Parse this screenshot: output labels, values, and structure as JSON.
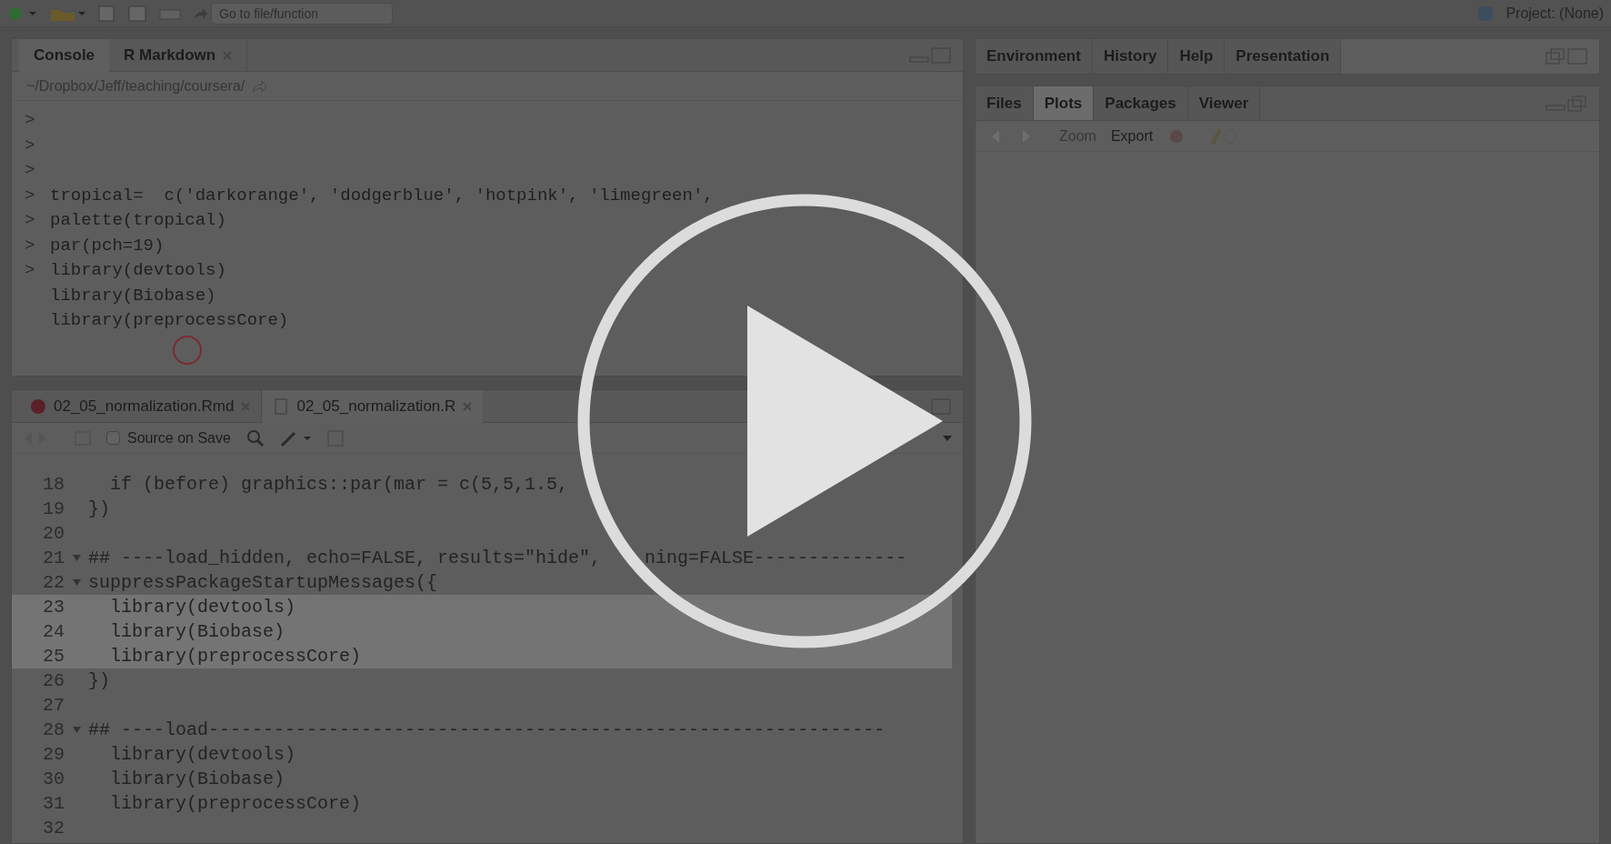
{
  "toolbar": {
    "search": {
      "placeholder": "Go to file/function"
    },
    "project": "Project: (None)"
  },
  "console_pane": {
    "tabs": [
      {
        "label": "Console",
        "selected": true,
        "closable": false
      },
      {
        "label": "R Markdown",
        "selected": false,
        "closable": true
      }
    ],
    "path": "~/Dropbox/Jeff/teaching/coursera/",
    "lines": [
      {
        "prompt": ">"
      },
      {
        "prompt": ">"
      },
      {
        "prompt": ">"
      },
      {
        "prompt": ">",
        "code": "tropical=  c('darkorange', 'dodgerblue', 'hotpink', 'limegreen',"
      },
      {
        "prompt": ">",
        "code": "palette(tropical)"
      },
      {
        "prompt": ">",
        "code": "par(pch=19)"
      },
      {
        "prompt": ">",
        "code": "library(devtools)"
      },
      {
        "code": "library(Biobase)"
      },
      {
        "code": "library(preprocessCore)"
      }
    ]
  },
  "editor": {
    "tabs": [
      {
        "label": "02_05_normalization.Rmd",
        "selected": false,
        "kind": "rmd"
      },
      {
        "label": "02_05_normalization.R",
        "selected": true,
        "kind": "r"
      }
    ],
    "source_on_save": {
      "label": "Source on Save",
      "checked": false
    },
    "lines": [
      {
        "number": "18",
        "foldable": false,
        "selected": false,
        "segments": [
          "  if (before) graphics::par(mar = c(5,5,1.5,"
        ]
      },
      {
        "number": "19",
        "foldable": false,
        "selected": false,
        "segments": [
          "})"
        ]
      },
      {
        "number": "20",
        "foldable": false,
        "selected": false
      },
      {
        "number": "21",
        "foldable": true,
        "selected": false,
        "segments": [
          "## ----load_hidden, echo=FALSE, results=\"hide\",",
          "ning=FALSE--------------"
        ]
      },
      {
        "number": "22",
        "foldable": true,
        "selected": false,
        "segments": [
          "suppressPackageStartupMessages({"
        ]
      },
      {
        "number": "23",
        "foldable": false,
        "selected": true,
        "segments": [
          "  library(devtools)"
        ]
      },
      {
        "number": "24",
        "foldable": false,
        "selected": true,
        "segments": [
          "  library(Biobase)"
        ]
      },
      {
        "number": "25",
        "foldable": false,
        "selected": true,
        "segments": [
          "  library(preprocessCore)"
        ]
      },
      {
        "number": "26",
        "foldable": false,
        "selected": false,
        "segments": [
          "})"
        ]
      },
      {
        "number": "27",
        "foldable": false,
        "selected": false
      },
      {
        "number": "28",
        "foldable": true,
        "selected": false,
        "segments": [
          "## ----load--------------------------------------------------------------"
        ]
      },
      {
        "number": "29",
        "foldable": false,
        "selected": false,
        "segments": [
          "  library(devtools)"
        ]
      },
      {
        "number": "30",
        "foldable": false,
        "selected": false,
        "segments": [
          "  library(Biobase)"
        ]
      },
      {
        "number": "31",
        "foldable": false,
        "selected": false,
        "segments": [
          "  library(preprocessCore)"
        ]
      },
      {
        "number": "32",
        "foldable": false,
        "selected": false
      }
    ]
  },
  "top_right_pane": {
    "tabs": [
      {
        "label": "Environment"
      },
      {
        "label": "History"
      },
      {
        "label": "Help"
      },
      {
        "label": "Presentation"
      }
    ]
  },
  "bottom_right_pane": {
    "tabs": [
      {
        "label": "Files",
        "selected": false
      },
      {
        "label": "Plots",
        "selected": true
      },
      {
        "label": "Packages",
        "selected": false
      },
      {
        "label": "Viewer",
        "selected": false
      }
    ],
    "zoom": {
      "label": "Zoom",
      "disabled": true
    },
    "export": {
      "label": "Export",
      "disabled": false
    }
  }
}
